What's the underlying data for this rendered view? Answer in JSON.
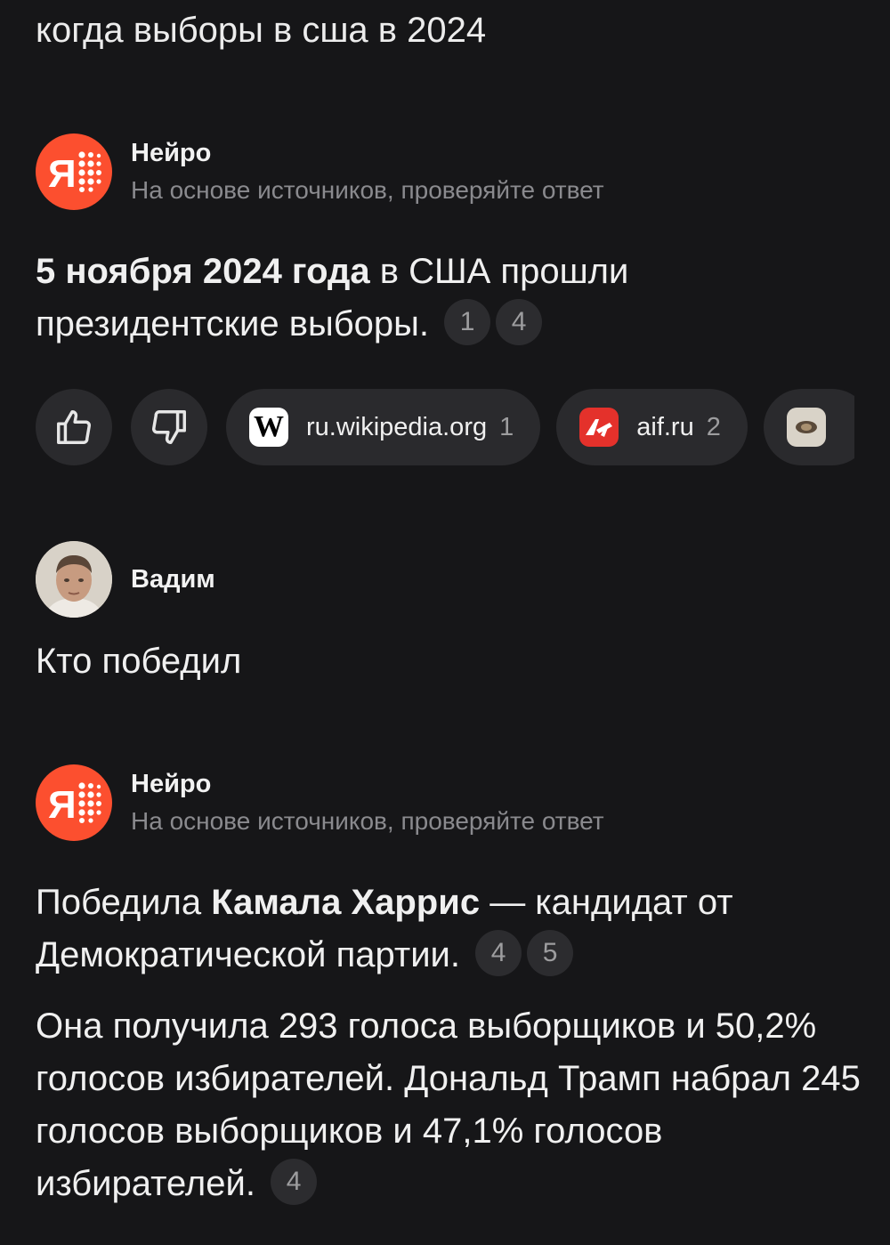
{
  "query": "когда выборы в сша в 2024",
  "neuro": {
    "name": "Нейро",
    "subtitle": "На основе источников, проверяйте ответ",
    "logo_letter": "Я"
  },
  "answer1": {
    "bold": "5 ноября 2024 года",
    "text": " в США прошли президентские выборы.",
    "refs": [
      "1",
      "4"
    ]
  },
  "sources": [
    {
      "icon": "wikipedia-icon",
      "icon_text": "W",
      "label": "ru.wikipedia.org",
      "count": "1"
    },
    {
      "icon": "aif-icon",
      "label": "aif.ru",
      "count": "2"
    }
  ],
  "user": {
    "name": "Вадим",
    "message": "Кто победил"
  },
  "answer2": {
    "p1_pre": "Победила ",
    "p1_bold": "Камала Харрис",
    "p1_post": " — кандидат от Демократической партии.",
    "p1_refs": [
      "4",
      "5"
    ],
    "p2": "Она получила 293 голоса выборщиков и 50,2% голосов избирателей. Дональд Трамп набрал 245 голосов выборщиков и 47,1% голосов избирателей.",
    "p2_refs": [
      "4"
    ]
  },
  "colors": {
    "background": "#161618",
    "neuro_brand": "#fc4f2f",
    "chip": "#2a2a2d",
    "muted": "#8a8a8e"
  }
}
